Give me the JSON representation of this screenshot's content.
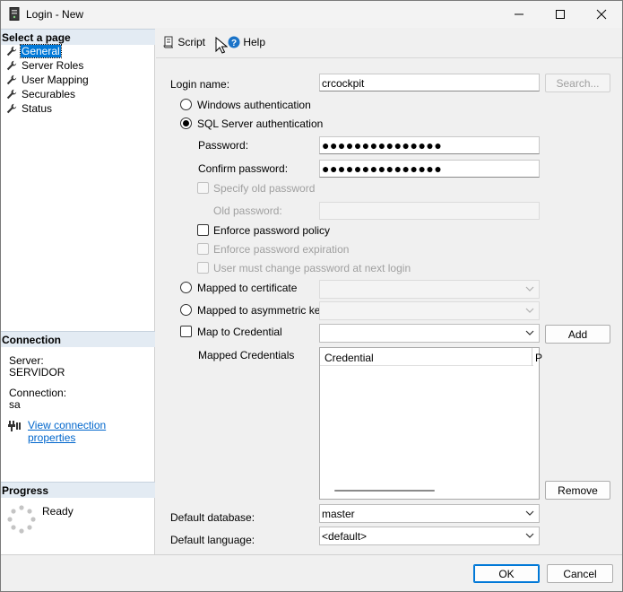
{
  "window": {
    "title": "Login - New"
  },
  "sidebar": {
    "select_page_header": "Select a page",
    "pages": [
      {
        "label": "General"
      },
      {
        "label": "Server Roles"
      },
      {
        "label": "User Mapping"
      },
      {
        "label": "Securables"
      },
      {
        "label": "Status"
      }
    ],
    "connection_header": "Connection",
    "server_label": "Server:",
    "server_value": "SERVIDOR",
    "connection_label": "Connection:",
    "connection_value": "sa",
    "view_connection_properties": "View connection properties",
    "progress_header": "Progress",
    "progress_status": "Ready"
  },
  "toolbar": {
    "script_label": "Script",
    "help_label": "Help"
  },
  "form": {
    "login_name_label": "Login name:",
    "login_name_value": "crcockpit",
    "search_button": "Search...",
    "windows_auth_label": "Windows authentication",
    "sql_auth_label": "SQL Server authentication",
    "password_label": "Password:",
    "password_value": "●●●●●●●●●●●●●●●",
    "confirm_password_label": "Confirm password:",
    "confirm_password_value": "●●●●●●●●●●●●●●●",
    "specify_old_password_label": "Specify old password",
    "old_password_label": "Old password:",
    "enforce_policy_label": "Enforce password policy",
    "enforce_expiration_label": "Enforce password expiration",
    "must_change_label": "User must change password at next login",
    "mapped_certificate_label": "Mapped to certificate",
    "mapped_asymmetric_label": "Mapped to asymmetric key",
    "map_credential_label": "Map to Credential",
    "add_button": "Add",
    "mapped_credentials_label": "Mapped Credentials",
    "grid_columns": [
      "Credential",
      "P"
    ],
    "remove_button": "Remove",
    "default_database_label": "Default database:",
    "default_database_value": "master",
    "default_language_label": "Default language:",
    "default_language_value": "<default>"
  },
  "footer": {
    "ok_button": "OK",
    "cancel_button": "Cancel"
  },
  "colors": {
    "accent": "#0078d7",
    "link": "#0066cc",
    "section_header_bg": "#e3ebf3",
    "help_icon": "#1a73c8"
  },
  "icons": {
    "app": "server-icon",
    "page": "wrench-icon",
    "script": "script-icon",
    "help": "help-icon",
    "connection": "plug-icon",
    "progress": "spinner-icon"
  }
}
